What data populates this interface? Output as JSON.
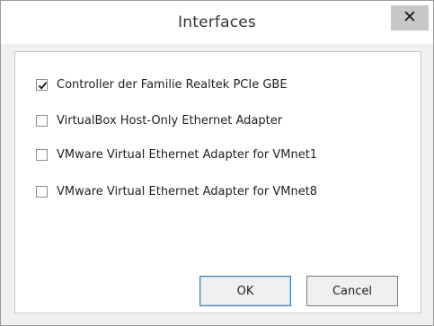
{
  "dialog": {
    "title": "Interfaces",
    "close_label": "✕"
  },
  "interfaces": [
    {
      "label": "Controller der Familie Realtek PCIe GBE",
      "checked": true
    },
    {
      "label": "VirtualBox Host-Only Ethernet Adapter",
      "checked": false
    },
    {
      "label": "VMware Virtual Ethernet Adapter for VMnet1",
      "checked": false
    },
    {
      "label": "VMware Virtual Ethernet Adapter for VMnet8",
      "checked": false
    }
  ],
  "buttons": {
    "ok_label": "OK",
    "cancel_label": "Cancel"
  }
}
